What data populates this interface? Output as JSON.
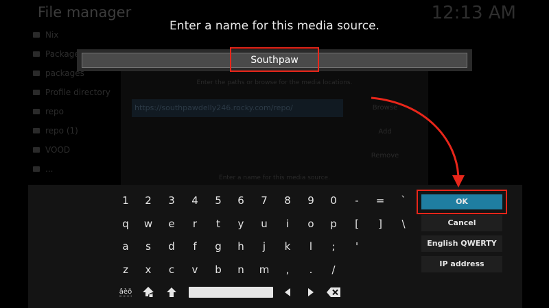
{
  "app": {
    "title": "File manager",
    "clock": "12:13 AM"
  },
  "file_list": [
    {
      "label": "Nix"
    },
    {
      "label": "Packages"
    },
    {
      "label": "packages"
    },
    {
      "label": "Profile directory"
    },
    {
      "label": "repo"
    },
    {
      "label": "repo (1)"
    },
    {
      "label": "VOOD"
    },
    {
      "label": "..."
    }
  ],
  "source_dialog": {
    "instruction": "Enter the paths or browse for the media locations.",
    "path": "https://southpawdelly246.rocky.com/repo/",
    "browse_label": "Browse",
    "add_label": "Add",
    "remove_label": "Remove",
    "name_hint": "Enter a name for this media source."
  },
  "prompt": "Enter a name for this media source.",
  "name_field": {
    "value": "Southpaw"
  },
  "keyboard": {
    "row1": [
      "1",
      "2",
      "3",
      "4",
      "5",
      "6",
      "7",
      "8",
      "9",
      "0",
      "-",
      "=",
      "`"
    ],
    "row2": [
      "q",
      "w",
      "e",
      "r",
      "t",
      "y",
      "u",
      "i",
      "o",
      "p",
      "[",
      "]",
      "\\"
    ],
    "row3": [
      "a",
      "s",
      "d",
      "f",
      "g",
      "h",
      "j",
      "k",
      "l",
      ";",
      "'"
    ],
    "row4": [
      "z",
      "x",
      "c",
      "v",
      "b",
      "n",
      "m",
      ",",
      ".",
      "/"
    ],
    "symbols_label": "âèö",
    "ok_label": "OK",
    "cancel_label": "Cancel",
    "layout_label": "English QWERTY",
    "ip_label": "IP address"
  },
  "colors": {
    "accent": "#1f7ea1",
    "annotation": "#e8261a"
  }
}
